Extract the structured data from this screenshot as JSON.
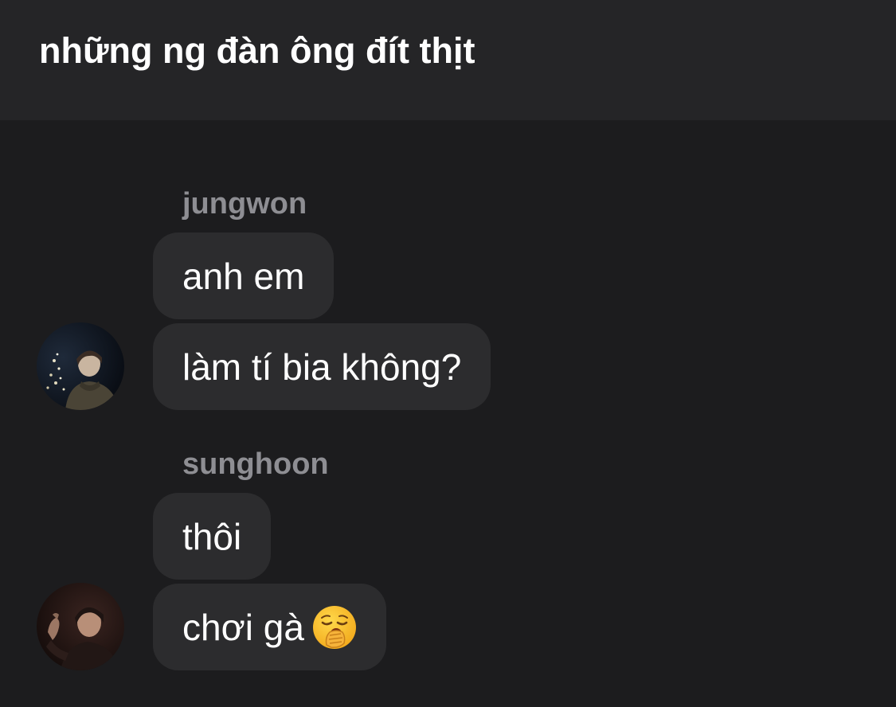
{
  "header": {
    "title": "những ng đàn ông đít thịt"
  },
  "messages": [
    {
      "sender": "jungwon",
      "bubbles": [
        "anh em",
        "làm tí bia không?"
      ]
    },
    {
      "sender": "sunghoon",
      "bubbles": [
        "thôi",
        "chơi gà"
      ],
      "emoji": "yawning-face-emoji"
    }
  ],
  "colors": {
    "background": "#1c1c1e",
    "header": "#252527",
    "bubble": "#2c2c2e",
    "sender_name": "#8e8e93",
    "text": "#ffffff"
  },
  "icons": [
    "avatar-photo-jungwon",
    "avatar-photo-sunghoon",
    "yawning-face-emoji"
  ]
}
